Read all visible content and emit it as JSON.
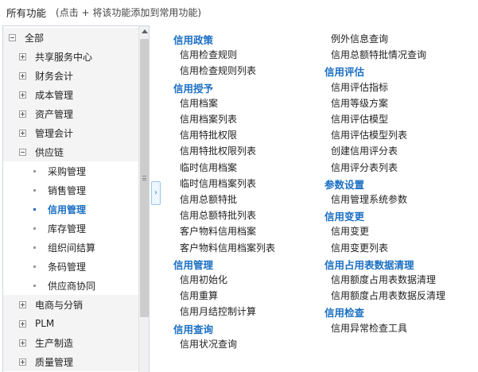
{
  "header": {
    "title": "所有功能",
    "hint": "(点击 + 将该功能添加到常用功能)"
  },
  "tree": {
    "items": [
      {
        "label": "全部",
        "level": 0,
        "icon": "minus-box-icon",
        "expanded": true
      },
      {
        "label": "共享服务中心",
        "level": 1,
        "icon": "plus-box-icon"
      },
      {
        "label": "财务会计",
        "level": 1,
        "icon": "plus-box-icon"
      },
      {
        "label": "成本管理",
        "level": 1,
        "icon": "plus-box-icon"
      },
      {
        "label": "资产管理",
        "level": 1,
        "icon": "plus-box-icon"
      },
      {
        "label": "管理会计",
        "level": 1,
        "icon": "plus-box-icon"
      },
      {
        "label": "供应链",
        "level": 1,
        "icon": "minus-box-icon",
        "expanded": true
      },
      {
        "label": "采购管理",
        "level": 2,
        "icon": "bullet-icon"
      },
      {
        "label": "销售管理",
        "level": 2,
        "icon": "bullet-icon"
      },
      {
        "label": "信用管理",
        "level": 2,
        "icon": "bullet-icon",
        "selected": true
      },
      {
        "label": "库存管理",
        "level": 2,
        "icon": "bullet-icon"
      },
      {
        "label": "组织间结算",
        "level": 2,
        "icon": "bullet-icon"
      },
      {
        "label": "条码管理",
        "level": 2,
        "icon": "bullet-icon"
      },
      {
        "label": "供应商协同",
        "level": 2,
        "icon": "bullet-icon"
      },
      {
        "label": "电商与分销",
        "level": 1,
        "icon": "plus-box-icon"
      },
      {
        "label": "PLM",
        "level": 1,
        "icon": "plus-box-icon"
      },
      {
        "label": "生产制造",
        "level": 1,
        "icon": "plus-box-icon"
      },
      {
        "label": "质量管理",
        "level": 1,
        "icon": "plus-box-icon"
      }
    ]
  },
  "content": {
    "columns": [
      [
        {
          "type": "category",
          "label": "信用政策"
        },
        {
          "type": "item",
          "label": "信用检查规则"
        },
        {
          "type": "item",
          "label": "信用检查规则列表"
        },
        {
          "type": "category",
          "label": "信用授予"
        },
        {
          "type": "item",
          "label": "信用档案"
        },
        {
          "type": "item",
          "label": "信用档案列表"
        },
        {
          "type": "item",
          "label": "信用特批权限"
        },
        {
          "type": "item",
          "label": "信用特批权限列表"
        },
        {
          "type": "item",
          "label": "临时信用档案"
        },
        {
          "type": "item",
          "label": "临时信用档案列表"
        },
        {
          "type": "item",
          "label": "信用总额特批"
        },
        {
          "type": "item",
          "label": "信用总额特批列表"
        },
        {
          "type": "item",
          "label": "客户物料信用档案"
        },
        {
          "type": "item",
          "label": "客户物料信用档案列表"
        },
        {
          "type": "category",
          "label": "信用管理"
        },
        {
          "type": "item",
          "label": "信用初始化"
        },
        {
          "type": "item",
          "label": "信用重算"
        },
        {
          "type": "item",
          "label": "信用月结控制计算"
        },
        {
          "type": "category",
          "label": "信用查询"
        },
        {
          "type": "item",
          "label": "信用状况查询"
        }
      ],
      [
        {
          "type": "item",
          "label": "例外信息查询"
        },
        {
          "type": "item",
          "label": "信用总额特批情况查询"
        },
        {
          "type": "category",
          "label": "信用评估"
        },
        {
          "type": "item",
          "label": "信用评估指标"
        },
        {
          "type": "item",
          "label": "信用等级方案"
        },
        {
          "type": "item",
          "label": "信用评估模型"
        },
        {
          "type": "item",
          "label": "信用评估模型列表"
        },
        {
          "type": "item",
          "label": "创建信用评分表"
        },
        {
          "type": "item",
          "label": "信用评分表列表"
        },
        {
          "type": "category",
          "label": "参数设置"
        },
        {
          "type": "item",
          "label": "信用管理系统参数"
        },
        {
          "type": "category",
          "label": "信用变更"
        },
        {
          "type": "item",
          "label": "信用变更"
        },
        {
          "type": "item",
          "label": "信用变更列表"
        },
        {
          "type": "category",
          "label": "信用占用表数据清理"
        },
        {
          "type": "item",
          "label": "信用额度占用表数据清理"
        },
        {
          "type": "item",
          "label": "信用额度占用表数据反清理"
        },
        {
          "type": "category",
          "label": "信用检查"
        },
        {
          "type": "item",
          "label": "信用异常检查工具"
        }
      ]
    ]
  },
  "colors": {
    "accent": "#1b6fc3",
    "text": "#222222",
    "border": "#cfd6dd"
  }
}
